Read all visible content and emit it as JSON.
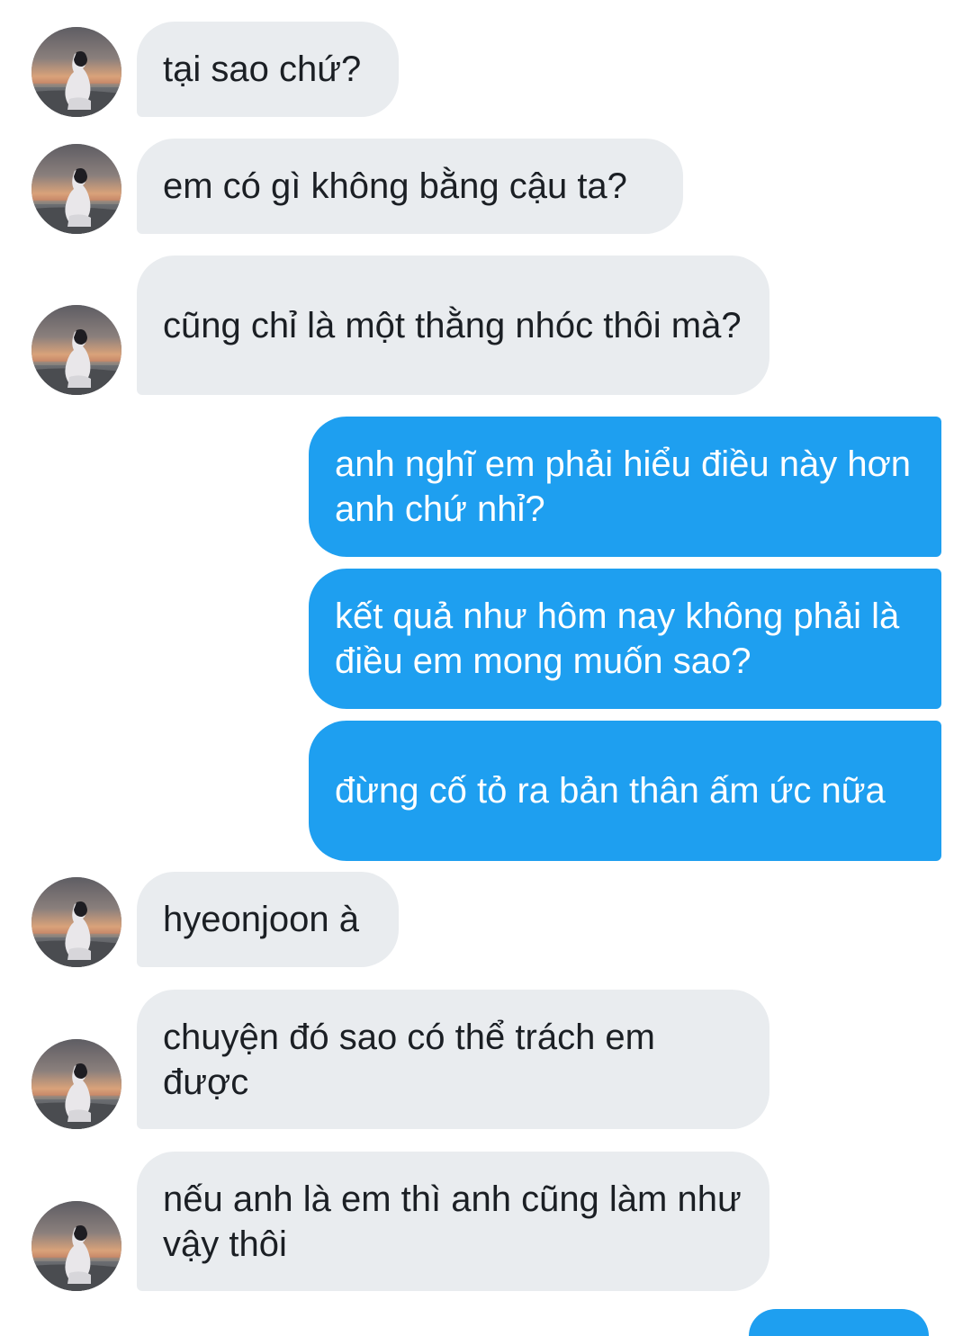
{
  "conversation": {
    "messages": [
      {
        "side": "in",
        "text": "tại sao chứ?"
      },
      {
        "side": "in",
        "text": "em có gì không bằng cậu ta?"
      },
      {
        "side": "in",
        "text": "cũng chỉ là một thằng nhóc thôi mà?"
      },
      {
        "side": "out",
        "text": "anh nghĩ em phải hiểu điều này hơn anh chứ nhỉ?"
      },
      {
        "side": "out",
        "text": "kết quả như hôm nay không phải là điều em mong muốn sao?"
      },
      {
        "side": "out",
        "text": "đừng cố tỏ ra bản thân ấm ức nữa"
      },
      {
        "side": "in",
        "text": "hyeonjoon à"
      },
      {
        "side": "in",
        "text": "chuyện đó sao có thể trách em được"
      },
      {
        "side": "in",
        "text": "nếu anh là em thì anh cũng làm như vậy thôi"
      }
    ]
  },
  "avatar": {
    "icon": "contact-avatar-photo"
  },
  "colors": {
    "incoming_bubble": "#e9ecef",
    "outgoing_bubble": "#1e9ff0",
    "incoming_text": "#1b1f24",
    "outgoing_text": "#ffffff"
  }
}
